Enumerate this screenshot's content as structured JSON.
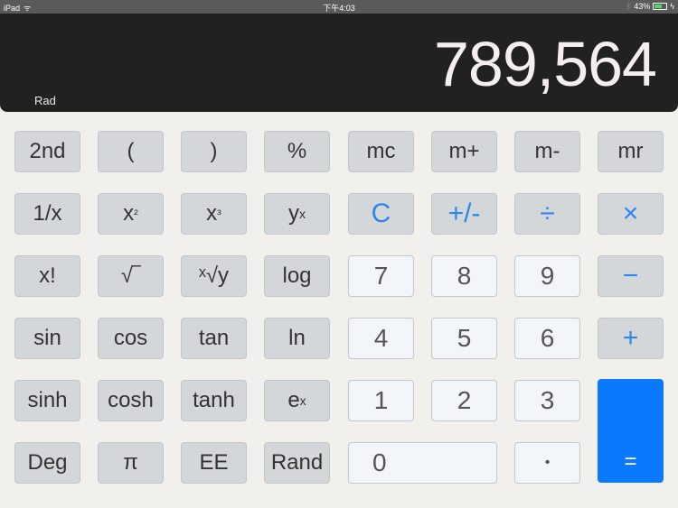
{
  "status_bar": {
    "device": "iPad",
    "time": "下午4:03",
    "battery_percent": "43%",
    "battery_level": 0.43
  },
  "display": {
    "value": "789,564",
    "angle_mode": "Rad"
  },
  "keys": {
    "second": "2nd",
    "lparen": "(",
    "rparen": ")",
    "percent": "%",
    "mc": "mc",
    "mplus": "m+",
    "mminus": "m-",
    "mr": "mr",
    "reciprocal": "1/x",
    "square_base": "x",
    "square_exp": "²",
    "cube_base": "x",
    "cube_exp": "³",
    "power_base": "y",
    "power_exp": "x",
    "clear": "C",
    "negate": "+/-",
    "divide": "÷",
    "multiply": "×",
    "factorial": "x!",
    "sqrt": "√‾",
    "xroot": "ˣ√y",
    "log": "log",
    "seven": "7",
    "eight": "8",
    "nine": "9",
    "minus": "−",
    "sin": "sin",
    "cos": "cos",
    "tan": "tan",
    "ln": "ln",
    "four": "4",
    "five": "5",
    "six": "6",
    "plus": "+",
    "sinh": "sinh",
    "cosh": "cosh",
    "tanh": "tanh",
    "exp_base": "e",
    "exp_exp": "x",
    "one": "1",
    "two": "2",
    "three": "3",
    "deg": "Deg",
    "pi": "π",
    "ee": "EE",
    "rand": "Rand",
    "zero": "0",
    "decimal": "•",
    "equals": "="
  }
}
